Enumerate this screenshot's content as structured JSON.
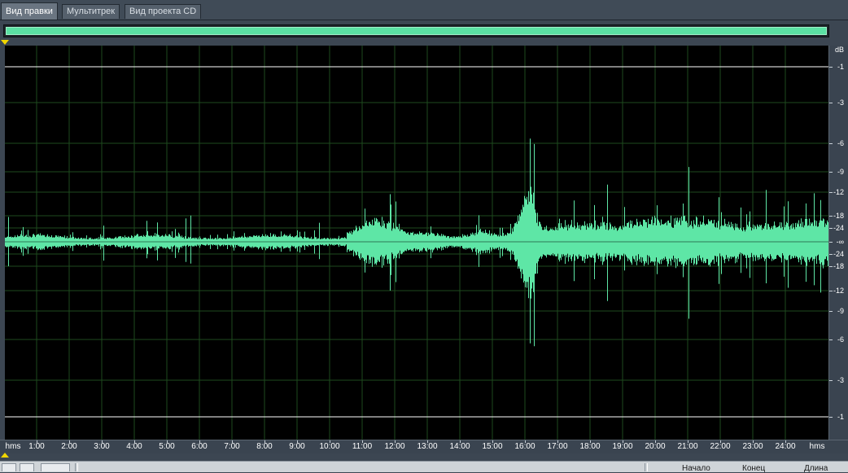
{
  "tabs": [
    {
      "label": "Вид правки",
      "active": true
    },
    {
      "label": "Мультитрек",
      "active": false
    },
    {
      "label": "Вид проекта CD",
      "active": false
    }
  ],
  "colors": {
    "waveform": "#5ee6a6",
    "background": "#000000",
    "grid": "#1e4a1e",
    "marker": "#f1d600"
  },
  "db_scale": {
    "unit": "dB",
    "labels": [
      "-1",
      "-3",
      "-6",
      "-9",
      "-12",
      "-18",
      "-24",
      "-∞",
      "-24",
      "-18",
      "-12",
      "-9",
      "-6",
      "-3",
      "-1"
    ]
  },
  "time_ruler": {
    "unit_left": "hms",
    "unit_right": "hms",
    "labels": [
      "1:00",
      "2:00",
      "3:00",
      "4:00",
      "5:00",
      "6:00",
      "7:00",
      "8:00",
      "9:00",
      "10:00",
      "11:00",
      "12:00",
      "13:00",
      "14:00",
      "15:00",
      "16:00",
      "17:00",
      "18:00",
      "19:00",
      "20:00",
      "21:00",
      "22:00",
      "23:00",
      "24:00"
    ]
  },
  "statusbar": {
    "start_label": "Начало",
    "end_label": "Конец",
    "length_label": "Длина"
  }
}
